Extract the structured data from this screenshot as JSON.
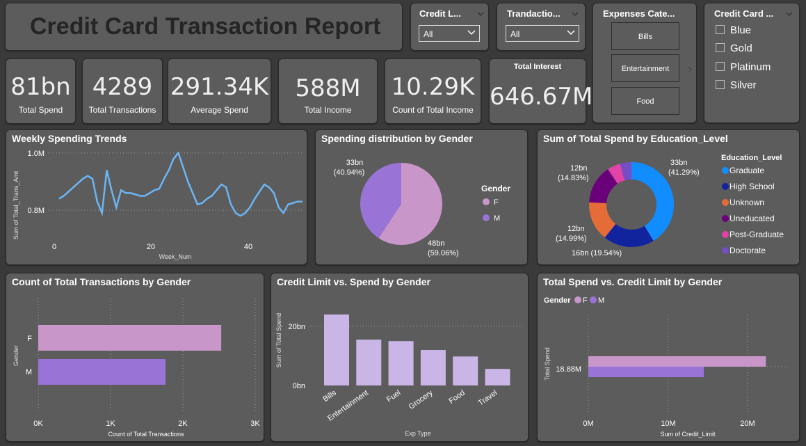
{
  "header": {
    "title": "Credit Card Transaction Report"
  },
  "slicers": {
    "credit_limit": {
      "title": "Credit L...",
      "value": "All"
    },
    "transaction": {
      "title": "Trandactio...",
      "value": "All"
    },
    "expenses": {
      "title": "Expenses Cate...",
      "options": [
        "Bills",
        "Entertainment",
        "Food"
      ]
    },
    "card": {
      "title": "Credit Card ...",
      "options": [
        "Blue",
        "Gold",
        "Platinum",
        "Silver"
      ]
    }
  },
  "kpis": {
    "total_spend": {
      "value": "81bn",
      "label": "Total Spend"
    },
    "total_transactions": {
      "value": "4289",
      "label": "Total Transactions"
    },
    "average_spend": {
      "value": "291.34K",
      "label": "Average Spend"
    },
    "total_income": {
      "value": "588M",
      "label": "Total Income"
    },
    "count_income": {
      "value": "10.29K",
      "label": "Count of Total Income"
    },
    "total_interest": {
      "value": "646.67M",
      "label": "Total Interest"
    }
  },
  "colors": {
    "f": "#c996c9",
    "m": "#9a73d6",
    "line": "#6cb6f5",
    "bar": "#c9b6e6",
    "graduate": "#118dff",
    "high_school": "#12239e",
    "unknown": "#e66c37",
    "uneducated": "#6b007b",
    "post_graduate": "#e044a7",
    "doctorate": "#744ec2"
  },
  "chart_data": [
    {
      "type": "line",
      "title": "Weekly Spending Trends",
      "xlabel": "Week_Num",
      "ylabel": "Sum of Total_Trans_Amt",
      "xlim": [
        0,
        52
      ],
      "ylim": [
        0.75,
        1.02
      ],
      "xticks": [
        "0",
        "20",
        "40"
      ],
      "yticks": [
        "1.0M",
        "0.8M"
      ],
      "x": [
        1,
        2,
        3,
        4,
        5,
        6,
        7,
        8,
        9,
        10,
        11,
        12,
        13,
        14,
        15,
        16,
        17,
        18,
        19,
        20,
        21,
        22,
        23,
        24,
        25,
        26,
        27,
        28,
        29,
        30,
        31,
        32,
        33,
        34,
        35,
        36,
        37,
        38,
        39,
        40,
        41,
        42,
        43,
        44,
        45,
        46,
        47,
        48,
        49,
        50,
        51,
        52
      ],
      "values": [
        0.84,
        0.85,
        0.865,
        0.88,
        0.895,
        0.91,
        0.92,
        0.91,
        0.83,
        0.79,
        0.94,
        0.87,
        0.81,
        0.87,
        0.86,
        0.86,
        0.855,
        0.85,
        0.85,
        0.86,
        0.87,
        0.875,
        0.91,
        0.94,
        0.98,
        1.0,
        0.95,
        0.9,
        0.86,
        0.82,
        0.825,
        0.84,
        0.85,
        0.87,
        0.89,
        0.88,
        0.82,
        0.79,
        0.78,
        0.79,
        0.81,
        0.84,
        0.865,
        0.89,
        0.88,
        0.86,
        0.81,
        0.79,
        0.82,
        0.825,
        0.83,
        0.83
      ]
    },
    {
      "type": "pie",
      "title": "Spending distribution by Gender",
      "legend_title": "Gender",
      "categories": [
        "F",
        "M"
      ],
      "values": [
        48,
        33
      ],
      "labels": [
        "48bn",
        "33bn"
      ],
      "percent_labels": [
        "(59.06%)",
        "(40.94%)"
      ]
    },
    {
      "type": "pie",
      "title": "Sum of Total Spend by Education_Level",
      "legend_title": "Education_Level",
      "categories": [
        "Graduate",
        "High School",
        "Unknown",
        "Uneducated",
        "Post-Graduate",
        "Doctorate"
      ],
      "values": [
        41.29,
        19.54,
        14.99,
        14.83,
        5.0,
        4.35
      ],
      "labels": [
        "33bn",
        "16bn (19.54%)",
        "12bn",
        "12bn"
      ],
      "percent_labels": [
        "(41.29%)",
        "(14.99%)",
        "(14.83%)"
      ]
    },
    {
      "type": "bar",
      "title": "Count of Total Transactions by Gender",
      "xlabel": "Count of Total Transactions",
      "ylabel": "Gender",
      "categories": [
        "F",
        "M"
      ],
      "values": [
        2530,
        1760
      ],
      "xlim": [
        0,
        3000
      ],
      "xticks": [
        "0K",
        "1K",
        "2K",
        "3K"
      ]
    },
    {
      "type": "bar",
      "title": "Credit Limit vs. Spend by Gender",
      "xlabel": "Exp Type",
      "ylabel": "Sum of Total Spend",
      "categories": [
        "Bills",
        "Entertainment",
        "Fuel",
        "Grocery",
        "Food",
        "Travel"
      ],
      "values": [
        24,
        15.5,
        15,
        12,
        9.8,
        5.6
      ],
      "ylim": [
        0,
        25
      ],
      "yticks": [
        "20bn",
        "0bn"
      ]
    },
    {
      "type": "bar",
      "title": "Total Spend vs. Credit Limit by Gender",
      "legend_title": "Gender",
      "xlabel": "Sum of Credit_Limit",
      "ylabel": "Total Spend",
      "series": [
        {
          "name": "F",
          "values": [
            22.3
          ]
        },
        {
          "name": "M",
          "values": [
            14.5
          ]
        }
      ],
      "categories": [
        "18.88M"
      ],
      "xlim": [
        0,
        25
      ],
      "xticks": [
        "0M",
        "10M",
        "20M"
      ]
    }
  ]
}
